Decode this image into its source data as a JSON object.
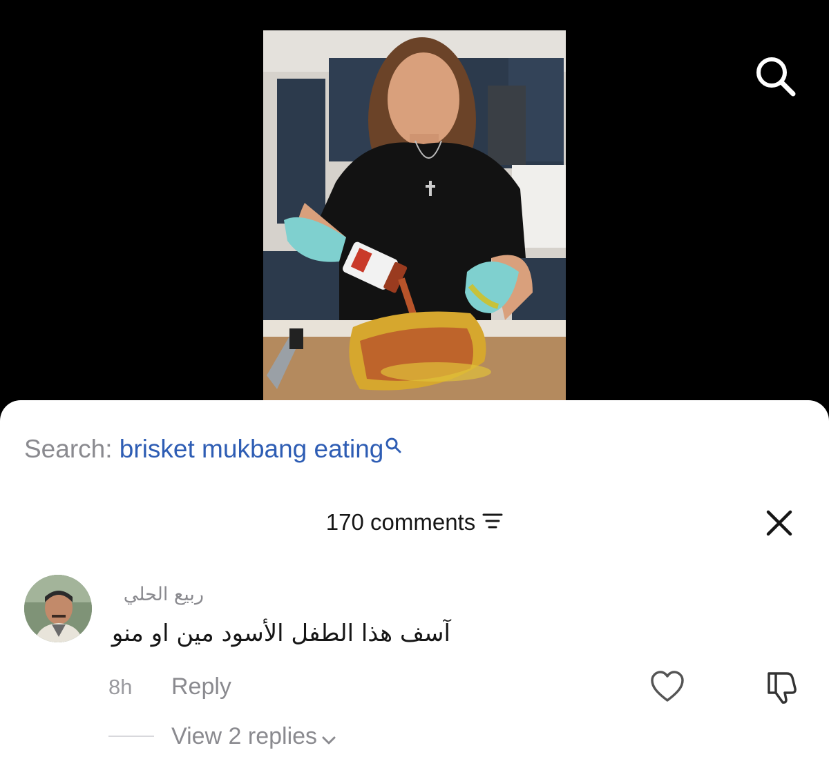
{
  "video": {
    "search_icon": "search-icon"
  },
  "search": {
    "prefix": "Search:",
    "query": "brisket mukbang eating",
    "query_color": "#2e5db4"
  },
  "comments": {
    "count_label": "170 comments",
    "sort_icon": "sort-lines-icon",
    "close_icon": "close-icon"
  },
  "comment": {
    "username": "ربيع الحلي",
    "text": "آسف هذا الطفل الأسود مين او منو",
    "time": "8h",
    "reply_label": "Reply",
    "like_icon": "heart-outline-icon",
    "dislike_icon": "thumbs-down-icon",
    "view_replies_label": "View 2 replies",
    "view_replies_icon": "chevron-down-icon"
  }
}
